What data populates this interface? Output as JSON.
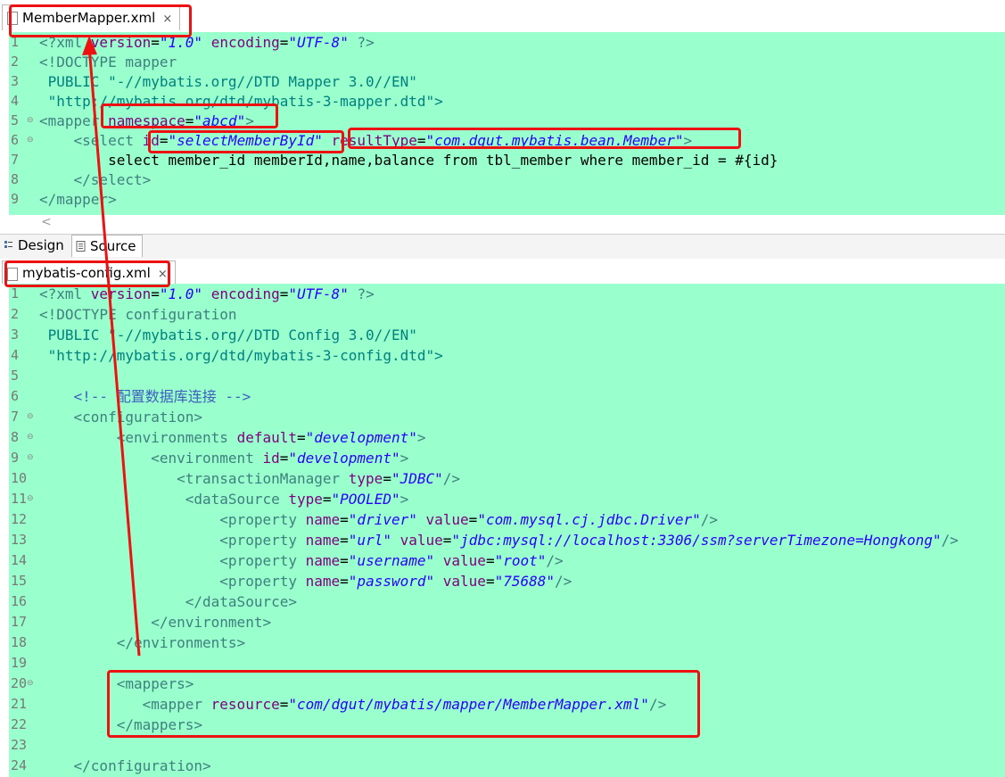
{
  "tabs": {
    "mapper_tab": "MemberMapper.xml",
    "config_tab": "mybatis-config.xml",
    "close_glyph": "×"
  },
  "bottom_tabs": {
    "design": "Design",
    "source": "Source"
  },
  "scroll_glyph": "<",
  "mapper_lines": [
    {
      "n": "1",
      "fold": "",
      "parts": [
        [
          "t",
          "<?xml "
        ],
        [
          "a",
          "version"
        ],
        [
          "",
          "="
        ],
        [
          "v",
          "\"1.0\""
        ],
        [
          "",
          " "
        ],
        [
          "a",
          "encoding"
        ],
        [
          "",
          "="
        ],
        [
          "v",
          "\"UTF-8\""
        ],
        [
          "",
          " "
        ],
        [
          "t",
          "?>"
        ]
      ]
    },
    {
      "n": "2",
      "fold": "",
      "parts": [
        [
          "t",
          "<!DOCTYPE mapper"
        ]
      ]
    },
    {
      "n": "3",
      "fold": "",
      "parts": [
        [
          "p",
          " PUBLIC "
        ],
        [
          "p",
          "\"-//mybatis.org//DTD Mapper 3.0//EN\""
        ]
      ]
    },
    {
      "n": "4",
      "fold": "",
      "parts": [
        [
          "p",
          " \"http://mybatis.org/dtd/mybatis-3-mapper.dtd\">"
        ]
      ]
    },
    {
      "n": "5",
      "fold": "⊖",
      "parts": [
        [
          "t",
          "<mapper "
        ],
        [
          "a",
          "namespace"
        ],
        [
          "",
          "="
        ],
        [
          "v",
          "\"abcd\""
        ],
        [
          "t",
          ">"
        ]
      ]
    },
    {
      "n": "6",
      "fold": "⊖",
      "parts": [
        [
          "t",
          "    <select "
        ],
        [
          "a",
          "id"
        ],
        [
          "",
          "="
        ],
        [
          "v",
          "\"selectMemberById\""
        ],
        [
          "",
          " "
        ],
        [
          "a",
          "resultType"
        ],
        [
          "",
          "="
        ],
        [
          "v",
          "\"com.dgut.mybatis.bean.Member\""
        ],
        [
          "t",
          ">"
        ]
      ]
    },
    {
      "n": "7",
      "fold": "",
      "parts": [
        [
          "",
          "        select member_id memberId,name,balance from tbl_member where member_id = #{id}"
        ]
      ]
    },
    {
      "n": "8",
      "fold": "",
      "parts": [
        [
          "t",
          "    </select>"
        ]
      ]
    },
    {
      "n": "9",
      "fold": "",
      "parts": [
        [
          "t",
          "</mapper>"
        ]
      ]
    }
  ],
  "config_lines": [
    {
      "n": "1",
      "fold": "",
      "parts": [
        [
          "t",
          "<?xml "
        ],
        [
          "a",
          "version"
        ],
        [
          "",
          "="
        ],
        [
          "v",
          "\"1.0\""
        ],
        [
          "",
          " "
        ],
        [
          "a",
          "encoding"
        ],
        [
          "",
          "="
        ],
        [
          "v",
          "\"UTF-8\""
        ],
        [
          "",
          " "
        ],
        [
          "t",
          "?>"
        ]
      ]
    },
    {
      "n": "2",
      "fold": "",
      "parts": [
        [
          "t",
          "<!DOCTYPE configuration"
        ]
      ]
    },
    {
      "n": "3",
      "fold": "",
      "parts": [
        [
          "p",
          " PUBLIC "
        ],
        [
          "p",
          "\"-//mybatis.org//DTD Config 3.0//EN\""
        ]
      ]
    },
    {
      "n": "4",
      "fold": "",
      "parts": [
        [
          "p",
          " \"http://mybatis.org/dtd/mybatis-3-config.dtd\">"
        ]
      ]
    },
    {
      "n": "5",
      "fold": "",
      "parts": []
    },
    {
      "n": "6",
      "fold": "",
      "parts": [
        [
          "c",
          "    <!-- 配置数据库连接 -->"
        ]
      ]
    },
    {
      "n": "7",
      "fold": "⊖",
      "parts": [
        [
          "t",
          "    <configuration>"
        ]
      ]
    },
    {
      "n": "8",
      "fold": "⊖",
      "parts": [
        [
          "t",
          "         <environments "
        ],
        [
          "a",
          "default"
        ],
        [
          "",
          "="
        ],
        [
          "v",
          "\"development\""
        ],
        [
          "t",
          ">"
        ]
      ]
    },
    {
      "n": "9",
      "fold": "⊖",
      "parts": [
        [
          "t",
          "             <environment "
        ],
        [
          "a",
          "id"
        ],
        [
          "",
          "="
        ],
        [
          "v",
          "\"development\""
        ],
        [
          "t",
          ">"
        ]
      ]
    },
    {
      "n": "10",
      "fold": "",
      "parts": [
        [
          "t",
          "                <transactionManager "
        ],
        [
          "a",
          "type"
        ],
        [
          "",
          "="
        ],
        [
          "v",
          "\"JDBC\""
        ],
        [
          "t",
          "/>"
        ]
      ]
    },
    {
      "n": "11",
      "fold": "⊖",
      "parts": [
        [
          "t",
          "                 <dataSource "
        ],
        [
          "a",
          "type"
        ],
        [
          "",
          "="
        ],
        [
          "v",
          "\"POOLED\""
        ],
        [
          "t",
          ">"
        ]
      ]
    },
    {
      "n": "12",
      "fold": "",
      "parts": [
        [
          "t",
          "                     <property "
        ],
        [
          "a",
          "name"
        ],
        [
          "",
          "="
        ],
        [
          "v",
          "\"driver\""
        ],
        [
          "",
          " "
        ],
        [
          "a",
          "value"
        ],
        [
          "",
          "="
        ],
        [
          "v",
          "\"com.mysql.cj.jdbc.Driver\""
        ],
        [
          "t",
          "/>"
        ]
      ]
    },
    {
      "n": "13",
      "fold": "",
      "parts": [
        [
          "t",
          "                     <property "
        ],
        [
          "a",
          "name"
        ],
        [
          "",
          "="
        ],
        [
          "v",
          "\"url\""
        ],
        [
          "",
          " "
        ],
        [
          "a",
          "value"
        ],
        [
          "",
          "="
        ],
        [
          "v",
          "\"jdbc:mysql://localhost:3306/ssm?serverTimezone=Hongkong\""
        ],
        [
          "t",
          "/>"
        ]
      ]
    },
    {
      "n": "14",
      "fold": "",
      "parts": [
        [
          "t",
          "                     <property "
        ],
        [
          "a",
          "name"
        ],
        [
          "",
          "="
        ],
        [
          "v",
          "\"username\""
        ],
        [
          "",
          " "
        ],
        [
          "a",
          "value"
        ],
        [
          "",
          "="
        ],
        [
          "v",
          "\"root\""
        ],
        [
          "t",
          "/>"
        ]
      ]
    },
    {
      "n": "15",
      "fold": "",
      "parts": [
        [
          "t",
          "                     <property "
        ],
        [
          "a",
          "name"
        ],
        [
          "",
          "="
        ],
        [
          "v",
          "\"password\""
        ],
        [
          "",
          " "
        ],
        [
          "a",
          "value"
        ],
        [
          "",
          "="
        ],
        [
          "v",
          "\"75688\""
        ],
        [
          "t",
          "/>"
        ]
      ]
    },
    {
      "n": "16",
      "fold": "",
      "parts": [
        [
          "t",
          "                 </dataSource>"
        ]
      ]
    },
    {
      "n": "17",
      "fold": "",
      "parts": [
        [
          "t",
          "             </environment>"
        ]
      ]
    },
    {
      "n": "18",
      "fold": "",
      "parts": [
        [
          "t",
          "         </environments>"
        ]
      ]
    },
    {
      "n": "19",
      "fold": "",
      "parts": []
    },
    {
      "n": "20",
      "fold": "⊖",
      "parts": [
        [
          "t",
          "         <mappers>"
        ]
      ]
    },
    {
      "n": "21",
      "fold": "",
      "parts": [
        [
          "t",
          "            <mapper "
        ],
        [
          "a",
          "resource"
        ],
        [
          "",
          "="
        ],
        [
          "v",
          "\"com/dgut/mybatis/mapper/MemberMapper.xml\""
        ],
        [
          "t",
          "/>"
        ]
      ]
    },
    {
      "n": "22",
      "fold": "",
      "parts": [
        [
          "t",
          "         </mappers>"
        ]
      ]
    },
    {
      "n": "23",
      "fold": "",
      "parts": []
    },
    {
      "n": "24",
      "fold": "",
      "parts": [
        [
          "t",
          "    </configuration>"
        ]
      ]
    }
  ],
  "colors": {
    "highlight_bg": "#99ffcc",
    "annotation": "#ee1111",
    "tag": "#3f7f7f",
    "attr": "#7f007f",
    "value": "#2a00ff"
  }
}
